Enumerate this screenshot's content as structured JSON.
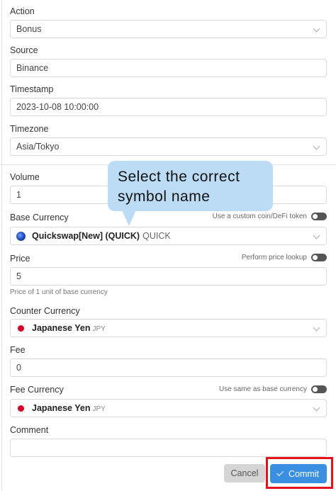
{
  "action": {
    "label": "Action",
    "value": "Bonus"
  },
  "source": {
    "label": "Source",
    "value": "Binance"
  },
  "timestamp": {
    "label": "Timestamp",
    "value": "2023-10-08 10:00:00"
  },
  "timezone": {
    "label": "Timezone",
    "value": "Asia/Tokyo"
  },
  "volume": {
    "label": "Volume",
    "value": "1"
  },
  "base_currency": {
    "label": "Base Currency",
    "toggle_label": "Use a custom coin/DeFi token",
    "name": "Quickswap[New] (QUICK)",
    "symbol": "QUICK",
    "icon": "quickswap-coin-icon"
  },
  "price": {
    "label": "Price",
    "toggle_label": "Perform price lookup",
    "value": "5",
    "hint": "Price of 1 unit of base currency"
  },
  "counter_currency": {
    "label": "Counter Currency",
    "name": "Japanese Yen",
    "symbol": "JPY",
    "icon": "japan-flag-icon"
  },
  "fee": {
    "label": "Fee",
    "value": "0"
  },
  "fee_currency": {
    "label": "Fee Currency",
    "toggle_label": "Use same as base currency",
    "name": "Japanese Yen",
    "symbol": "JPY",
    "icon": "japan-flag-icon"
  },
  "comment": {
    "label": "Comment",
    "value": ""
  },
  "tooltip": {
    "line1": "Select the correct",
    "line2": "symbol name"
  },
  "buttons": {
    "cancel": "Cancel",
    "commit": "Commit"
  },
  "colors": {
    "commit_bg": "#3a8fe0",
    "highlight": "#e3131b",
    "tooltip_bg": "#bcdcf6"
  }
}
